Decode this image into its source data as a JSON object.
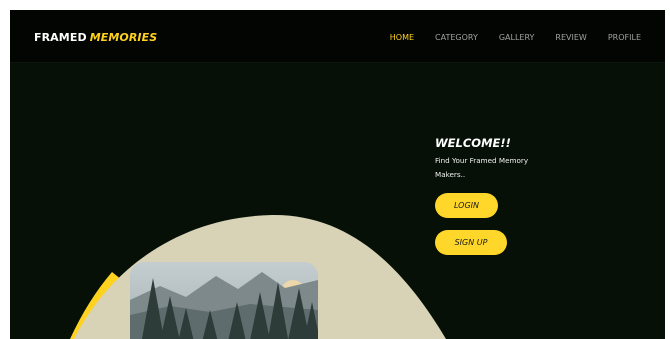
{
  "brand": {
    "part1": "FRAMED",
    "part2": "MEMORIES"
  },
  "nav": {
    "items": [
      "HOME",
      "CATEGORY",
      "GALLERY",
      "REVIEW",
      "PROFILE"
    ],
    "active": "HOME"
  },
  "hero": {
    "welcome": "WELCOME!!",
    "subtitle": "Find Your Framed Memory Makers..",
    "login_label": "LOGIN",
    "signup_label": "SIGN UP"
  },
  "colors": {
    "background": "#071007",
    "accent": "#ffd21f",
    "blob": "#d8d2b6"
  },
  "icons": {
    "hero_image": "mountain-forest-photo"
  }
}
